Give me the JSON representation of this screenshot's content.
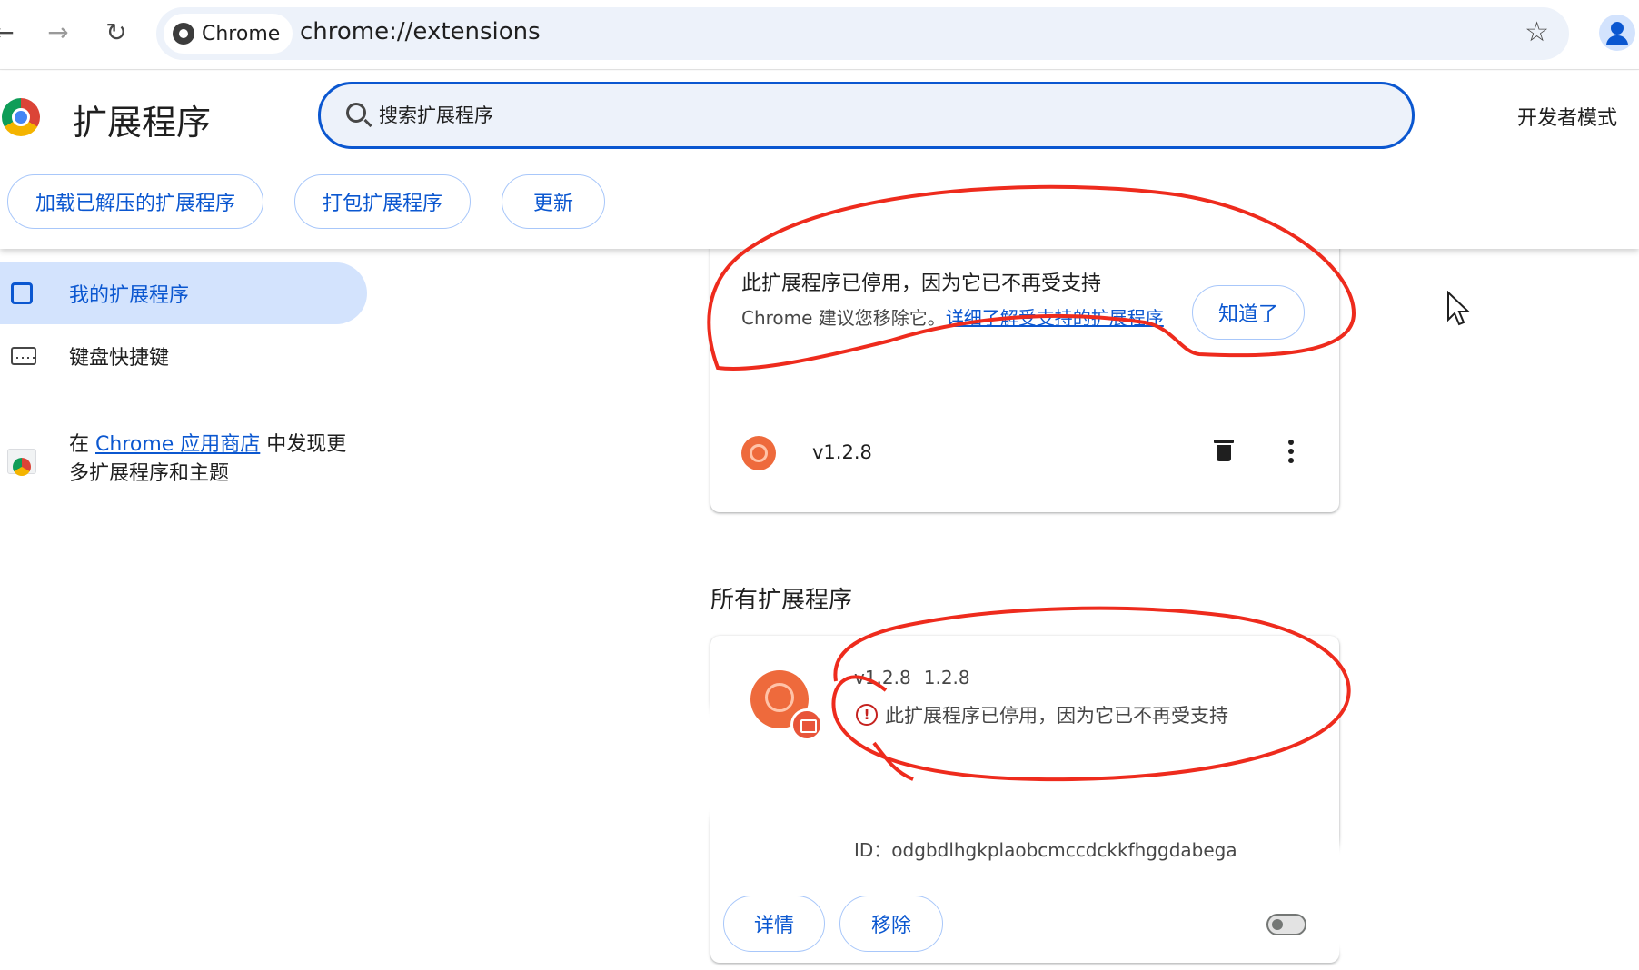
{
  "browser": {
    "chip_label": "Chrome",
    "url": "chrome://extensions",
    "icons": {
      "back": "arrow-left-icon",
      "forward": "arrow-right-icon",
      "reload": "reload-icon",
      "bookmark": "star-icon",
      "profile": "profile-icon"
    }
  },
  "header": {
    "title": "扩展程序",
    "search_placeholder": "搜索扩展程序",
    "dev_mode_label": "开发者模式",
    "buttons": {
      "load_unpacked": "加载已解压的扩展程序",
      "pack": "打包扩展程序",
      "update": "更新"
    }
  },
  "sidebar": {
    "items": [
      {
        "label": "我的扩展程序",
        "active": true
      },
      {
        "label": "键盘快捷键",
        "active": false
      }
    ],
    "store": {
      "prefix": "在 ",
      "link": "Chrome 应用商店",
      "suffix": " 中发现更多扩展程序和主题"
    }
  },
  "warning_card": {
    "title": "此扩展程序已停用，因为它已不再受支持",
    "desc_prefix": "Chrome 建议您移除它。",
    "link": "详细了解受支持的扩展程序",
    "got_it": "知道了",
    "version": "v1.2.8"
  },
  "section_title": "所有扩展程序",
  "extension_card": {
    "name": "v1.2.8",
    "version": "1.2.8",
    "error": "此扩展程序已停用，因为它已不再受支持",
    "id": "ID：odgbdlhgkplaobcmccdckkfhggdabega",
    "details_label": "详情",
    "remove_label": "移除",
    "enabled": false
  },
  "colors": {
    "accent": "#0b57d0",
    "annotation": "#ee2b1d",
    "extension_icon": "#ee6a3c"
  }
}
